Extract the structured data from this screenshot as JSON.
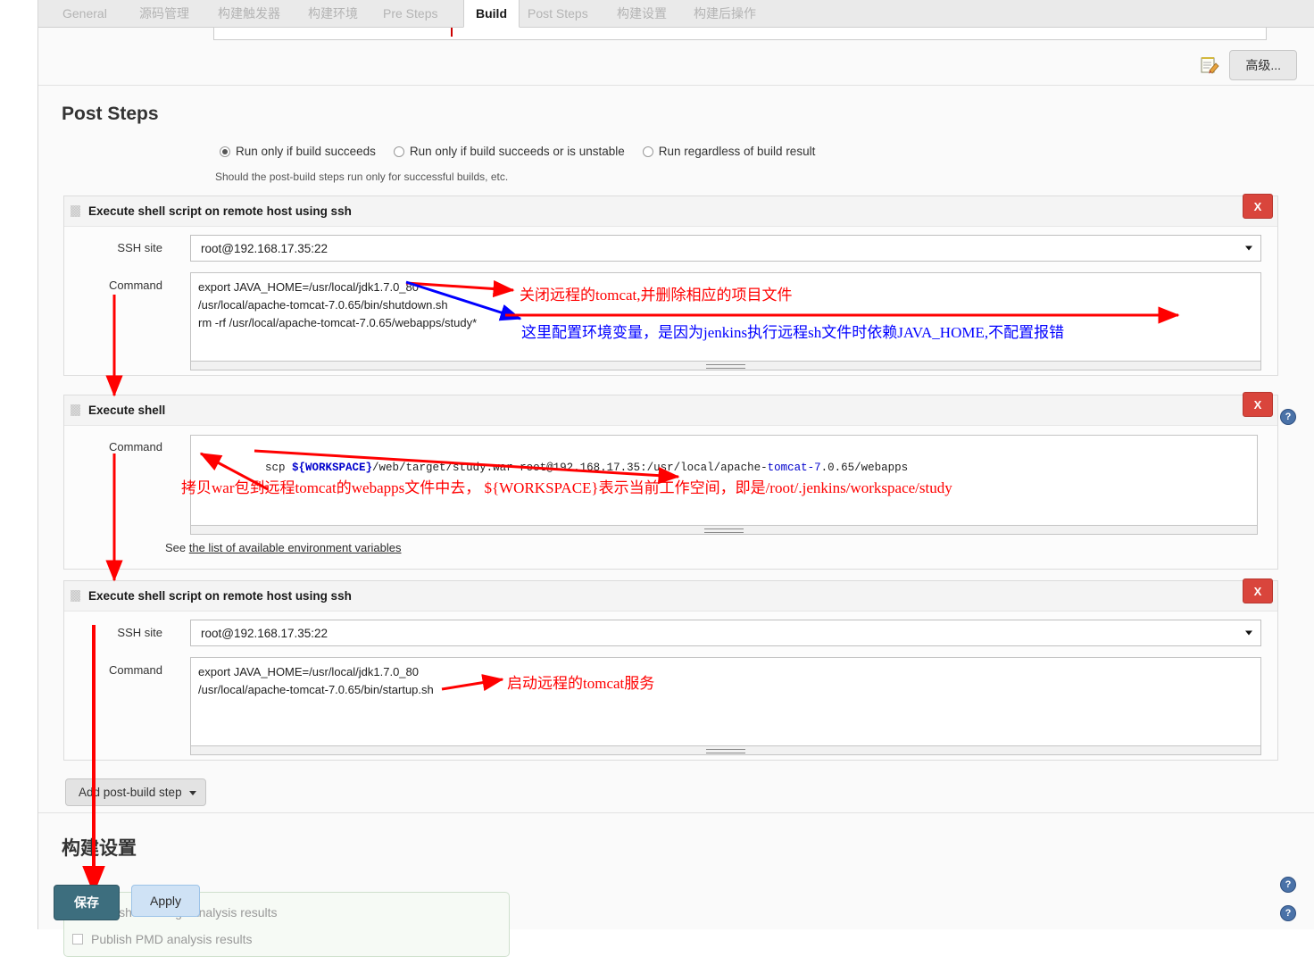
{
  "tabs": [
    {
      "label": "General",
      "active": false
    },
    {
      "label": "源码管理",
      "active": false
    },
    {
      "label": "构建触发器",
      "active": false
    },
    {
      "label": "构建环境",
      "active": false
    },
    {
      "label": "Pre Steps",
      "active": false
    },
    {
      "label": "Build",
      "active": true
    },
    {
      "label": "Post Steps",
      "active": false
    },
    {
      "label": "构建设置",
      "active": false
    },
    {
      "label": "构建后操作",
      "active": false
    }
  ],
  "toolbar": {
    "advanced_label": "高级...",
    "notepad_icon": "notepad-pencil-icon"
  },
  "post_steps": {
    "title": "Post Steps",
    "radios": [
      {
        "label": "Run only if build succeeds",
        "selected": true
      },
      {
        "label": "Run only if build succeeds or is unstable",
        "selected": false
      },
      {
        "label": "Run regardless of build result",
        "selected": false
      }
    ],
    "hint": "Should the post-build steps run only for successful builds, etc.",
    "add_step_label": "Add post-build step",
    "delete_label": "X",
    "help_label": "?"
  },
  "steps": [
    {
      "title": "Execute shell script on remote host using ssh",
      "ssh_site_label": "SSH site",
      "ssh_site_value": "root@192.168.17.35:22",
      "command_label": "Command",
      "command_value": "export JAVA_HOME=/usr/local/jdk1.7.0_80\n/usr/local/apache-tomcat-7.0.65/bin/shutdown.sh\nrm -rf /usr/local/apache-tomcat-7.0.65/webapps/study*"
    },
    {
      "title": "Execute shell",
      "command_label": "Command",
      "command_value": "scp ${WORKSPACE}/web/target/study.war root@192.168.17.35:/usr/local/apache-tomcat-7.0.65/webapps",
      "env_see": "See ",
      "env_link": "the list of available environment variables"
    },
    {
      "title": "Execute shell script on remote host using ssh",
      "ssh_site_label": "SSH site",
      "ssh_site_value": "root@192.168.17.35:22",
      "command_label": "Command",
      "command_value": "export JAVA_HOME=/usr/local/jdk1.7.0_80\n/usr/local/apache-tomcat-7.0.65/bin/startup.sh"
    }
  ],
  "build_settings": {
    "title": "构建设置",
    "checkboxes": [
      {
        "label": "Publish FindBugs analysis results",
        "checked": false
      },
      {
        "label": "Publish PMD analysis results",
        "checked": false
      }
    ]
  },
  "footer": {
    "save_label": "保存",
    "apply_label": "Apply"
  },
  "annotations": [
    {
      "id": "a1",
      "text": "关闭远程的tomcat,并删除相应的项目文件",
      "color": "#ff0000"
    },
    {
      "id": "a2",
      "text": "这里配置环境变量，是因为jenkins执行远程sh文件时依赖JAVA_HOME,不配置报错",
      "color": "#0000ff"
    },
    {
      "id": "a3",
      "text": "拷贝war包到远程tomcat的webapps文件中去，  ${WORKSPACE}表示当前工作空间，即是/root/.jenkins/workspace/study",
      "color": "#ff0000"
    },
    {
      "id": "a4",
      "text": "启动远程的tomcat服务",
      "color": "#ff0000"
    }
  ]
}
